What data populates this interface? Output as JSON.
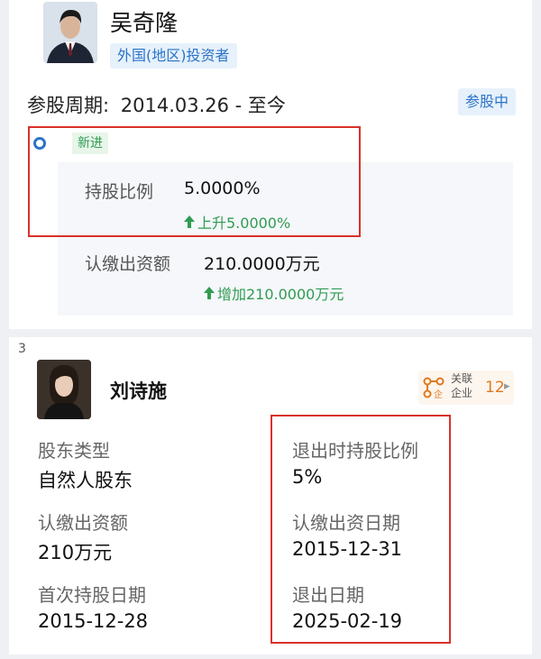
{
  "investor1": {
    "name": "吴奇隆",
    "type_tag": "外国(地区)投资者",
    "period_label": "参股周期:",
    "period_value": "2014.03.26 - 至今",
    "status_badge": "参股中",
    "event_tag": "新进",
    "share_ratio_label": "持股比例",
    "share_ratio_value": "5.0000%",
    "share_ratio_change": "上升5.0000%",
    "subscribed_label": "认缴出资额",
    "subscribed_value": "210.0000万元",
    "subscribed_change": "增加210.0000万元"
  },
  "investor2": {
    "index": "3",
    "name": "刘诗施",
    "related": {
      "line1": "关联",
      "line2": "企业",
      "count": "12"
    },
    "fields": [
      {
        "label": "股东类型",
        "value": "自然人股东"
      },
      {
        "label": "认缴出资额",
        "value": "210万元"
      },
      {
        "label": "首次持股日期",
        "value": "2015-12-28"
      },
      {
        "label": "退出时持股比例",
        "value": "5%"
      },
      {
        "label": "认缴出资日期",
        "value": "2015-12-31"
      },
      {
        "label": "退出日期",
        "value": "2025-02-19"
      }
    ]
  },
  "colors": {
    "accent_blue": "#2b73c9",
    "up_green": "#2f9c52",
    "highlight_red": "#d8322a",
    "related_orange": "#e07a1f"
  }
}
